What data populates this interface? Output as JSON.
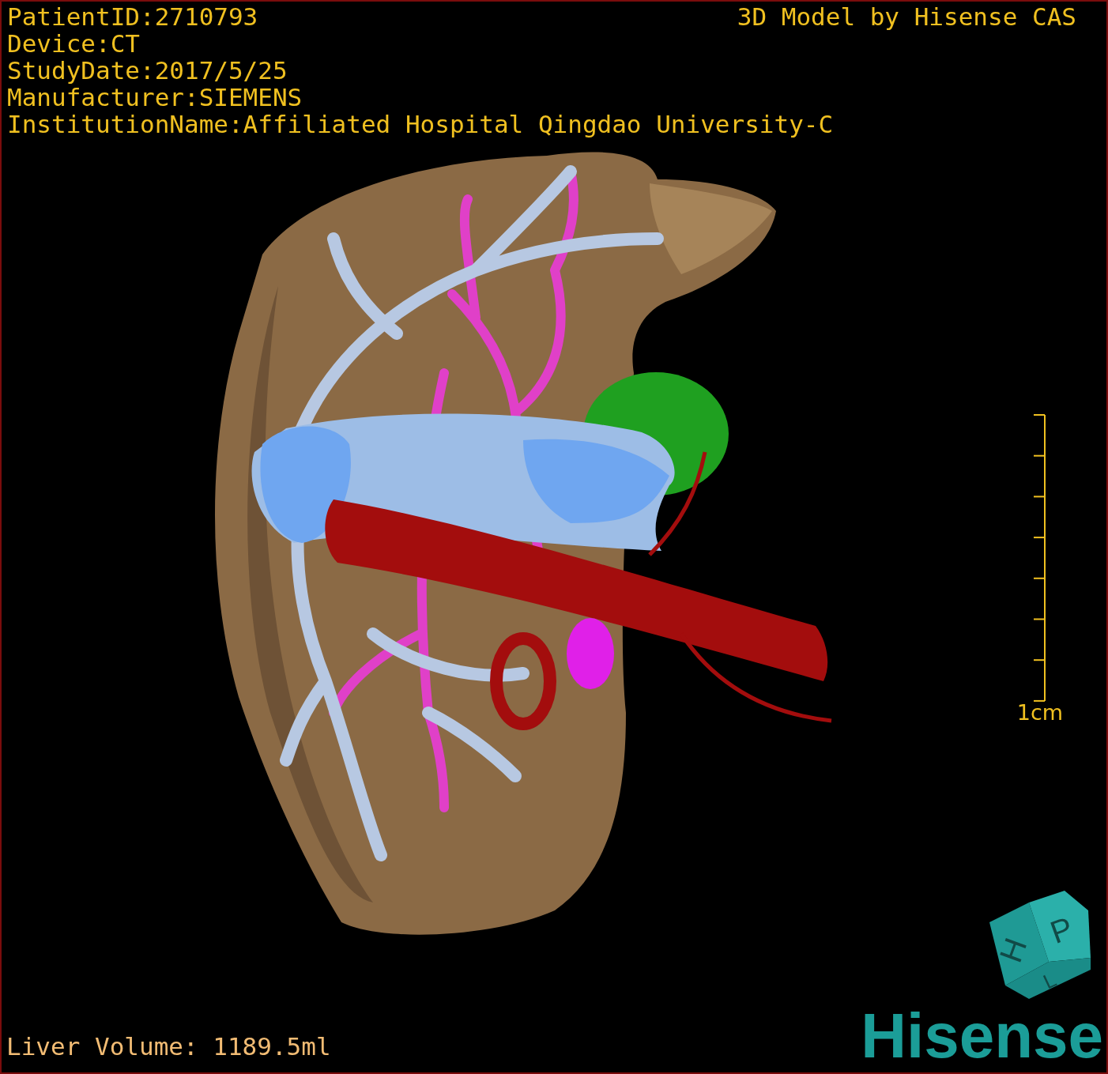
{
  "patient_info": [
    "PatientID:2710793",
    "Device:CT",
    "StudyDate:2017/5/25",
    "Manufacturer:SIEMENS",
    "InstitutionName:Affiliated Hospital Qingdao University-C"
  ],
  "credit": "3D Model by Hisense CAS",
  "scale_bar": {
    "label": "1cm"
  },
  "orientation_cube": {
    "labels": [
      "H",
      "P",
      "L"
    ]
  },
  "volume": "Liver Volume: 1189.5ml",
  "logo": "Hisense"
}
